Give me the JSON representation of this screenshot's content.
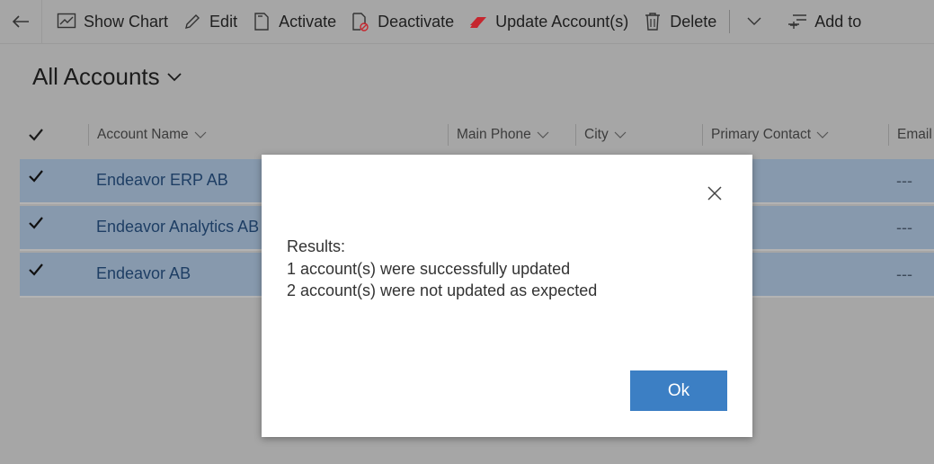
{
  "toolbar": {
    "show_chart": "Show Chart",
    "edit": "Edit",
    "activate": "Activate",
    "deactivate": "Deactivate",
    "update_accounts": "Update Account(s)",
    "delete": "Delete",
    "add_to": "Add to"
  },
  "view": {
    "title": "All Accounts"
  },
  "grid": {
    "columns": [
      "Account Name",
      "Main Phone",
      "City",
      "Primary Contact",
      "Email"
    ],
    "rows": [
      {
        "name": "Endeavor ERP AB",
        "email": "---"
      },
      {
        "name": "Endeavor Analytics AB",
        "email": "---"
      },
      {
        "name": "Endeavor AB",
        "email": "---"
      }
    ]
  },
  "dialog": {
    "line1": "Results:",
    "line2": "1 account(s) were successfully updated",
    "line3": "2 account(s) were not updated as expected",
    "ok_label": "Ok"
  },
  "colors": {
    "overlay": "#a6a6a6",
    "selected_row": "#8799ad",
    "ok_button": "#3c7fc4",
    "update_icon": "#c6262e"
  }
}
